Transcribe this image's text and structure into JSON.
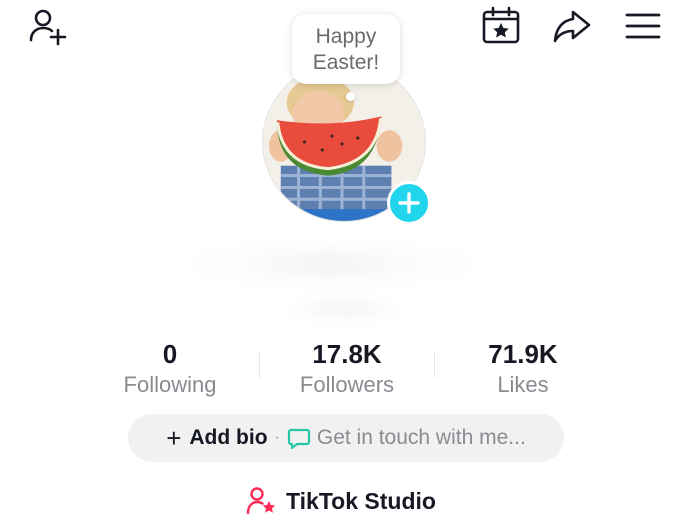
{
  "note": {
    "text": "Happy Easter!"
  },
  "stats": [
    {
      "value": "0",
      "label": "Following"
    },
    {
      "value": "17.8K",
      "label": "Followers"
    },
    {
      "value": "71.9K",
      "label": "Likes"
    }
  ],
  "bio": {
    "add_label": "Add bio",
    "separator": "·",
    "contact_label": "Get in touch with me..."
  },
  "studio": {
    "label": "TikTok Studio"
  },
  "colors": {
    "accent_cyan": "#20d5ec",
    "brand_pink": "#fe2c55",
    "contact_green": "#25c7a6",
    "text_primary": "#161823",
    "text_secondary": "#8a8b91",
    "pill_bg": "#f1f1f2"
  },
  "icons": {
    "top_left": "add-friend-icon",
    "top_right": [
      "calendar-star-icon",
      "share-icon",
      "menu-icon"
    ],
    "avatar_add": "plus-icon",
    "bio_contact": "chat-bubble-icon",
    "studio": "creator-star-icon"
  }
}
